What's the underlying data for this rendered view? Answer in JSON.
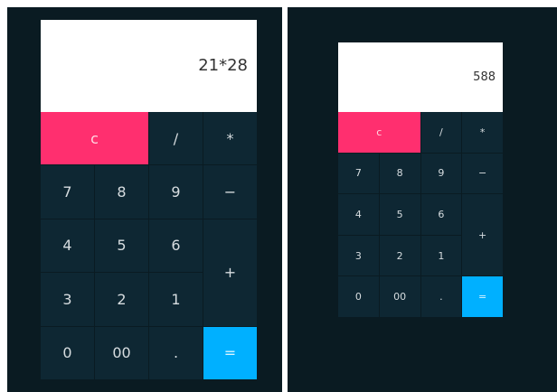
{
  "colors": {
    "background": "#0a1b22",
    "key": "#0e2733",
    "clear": "#ff2f6f",
    "equals": "#00b0ff",
    "display": "#ffffff"
  },
  "left_calculator": {
    "display": "21*28",
    "keys": {
      "clear": "c",
      "divide": "/",
      "multiply": "*",
      "seven": "7",
      "eight": "8",
      "nine": "9",
      "minus": "−",
      "four": "4",
      "five": "5",
      "six": "6",
      "plus": "+",
      "three": "3",
      "two": "2",
      "one": "1",
      "zero": "0",
      "double_zero": "00",
      "decimal": ".",
      "equals": "="
    }
  },
  "right_calculator": {
    "display": "588",
    "keys": {
      "clear": "c",
      "divide": "/",
      "multiply": "*",
      "seven": "7",
      "eight": "8",
      "nine": "9",
      "minus": "−",
      "four": "4",
      "five": "5",
      "six": "6",
      "plus": "+",
      "three": "3",
      "two": "2",
      "one": "1",
      "zero": "0",
      "double_zero": "00",
      "decimal": ".",
      "equals": "="
    }
  }
}
